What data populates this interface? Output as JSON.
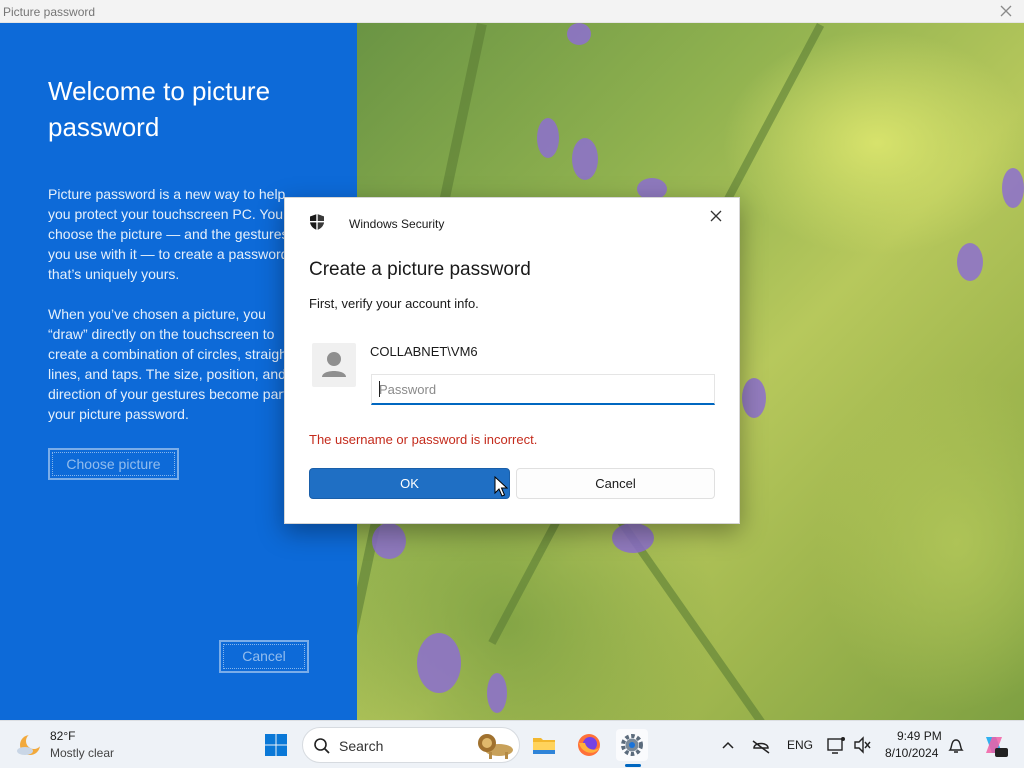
{
  "window": {
    "title": "Picture password"
  },
  "left_panel": {
    "heading": "Welcome to picture password",
    "paragraph1": "Picture password is a new way to help you protect your touchscreen PC. You choose the picture — and the gestures you use with it — to create a password that’s uniquely yours.",
    "paragraph2": "When you’ve chosen a picture, you “draw” directly on the touchscreen to create a combination of circles, straight lines, and taps. The size, position, and direction of your gestures become part of your picture password.",
    "choose_button": "Choose picture",
    "cancel_button": "Cancel"
  },
  "dialog": {
    "app_name": "Windows Security",
    "title": "Create a picture password",
    "subtitle": "First, verify your account info.",
    "username": "COLLABNET\\VM6",
    "password_placeholder": "Password",
    "password_value": "",
    "error": "The username or password is incorrect.",
    "ok_label": "OK",
    "cancel_label": "Cancel"
  },
  "taskbar": {
    "weather_temp": "82°F",
    "weather_condition": "Mostly clear",
    "search_label": "Search",
    "pinned": [
      "windows-start-icon",
      "file-explorer-icon",
      "firefox-icon",
      "settings-icon"
    ],
    "language": "ENG",
    "time": "9:49 PM",
    "date": "8/10/2024"
  },
  "colors": {
    "left_panel_bg": "#0d6ad8",
    "ok_button_bg": "#1f6fc4",
    "error_text": "#c42b1c",
    "input_underline": "#0067c0"
  }
}
